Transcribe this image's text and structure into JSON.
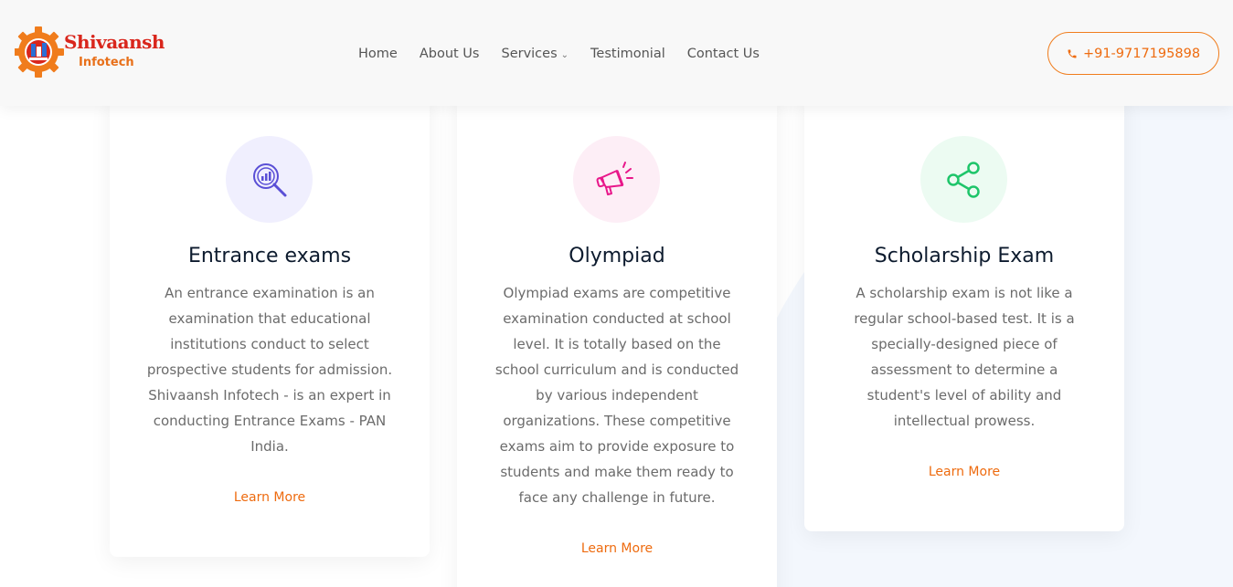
{
  "header": {
    "logo": {
      "line1": "Shivaansh",
      "line2": "Infotech"
    },
    "nav": [
      {
        "label": "Home"
      },
      {
        "label": "About Us"
      },
      {
        "label": "Services",
        "has_dropdown": true
      },
      {
        "label": "Testimonial"
      },
      {
        "label": "Contact Us"
      }
    ],
    "phone": "+91-9717195898"
  },
  "cards": [
    {
      "title": "Entrance exams",
      "icon": "chart-magnifier-icon",
      "icon_color": "#5a4fd6",
      "icon_bg": "#f0effe",
      "text": "An entrance examination is an examination that educational institutions conduct to select prospective students for admission. Shivaansh Infotech - is an expert in conducting Entrance Exams - PAN India.",
      "link": "Learn More"
    },
    {
      "title": "Olympiad",
      "icon": "megaphone-icon",
      "icon_color": "#e8178a",
      "icon_bg": "#fdeef6",
      "text": "Olympiad exams are competitive examination conducted at school level. It is totally based on the school curriculum and is conducted by various independent organizations. These competitive exams aim to provide exposure to students and make them ready to face any challenge in future.",
      "link": "Learn More"
    },
    {
      "title": "Scholarship Exam",
      "icon": "share-icon",
      "icon_color": "#1ec56a",
      "icon_bg": "#ecfbf2",
      "text": "A scholarship exam is not like a regular school-based test. It is a specially-designed piece of assessment to determine a student's level of ability and intellectual prowess.",
      "link": "Learn More"
    }
  ],
  "colors": {
    "accent": "#ee6b0f",
    "heading": "#0d1b2e",
    "body_text": "#6b6b6b",
    "blob": "#f3f7fd"
  }
}
